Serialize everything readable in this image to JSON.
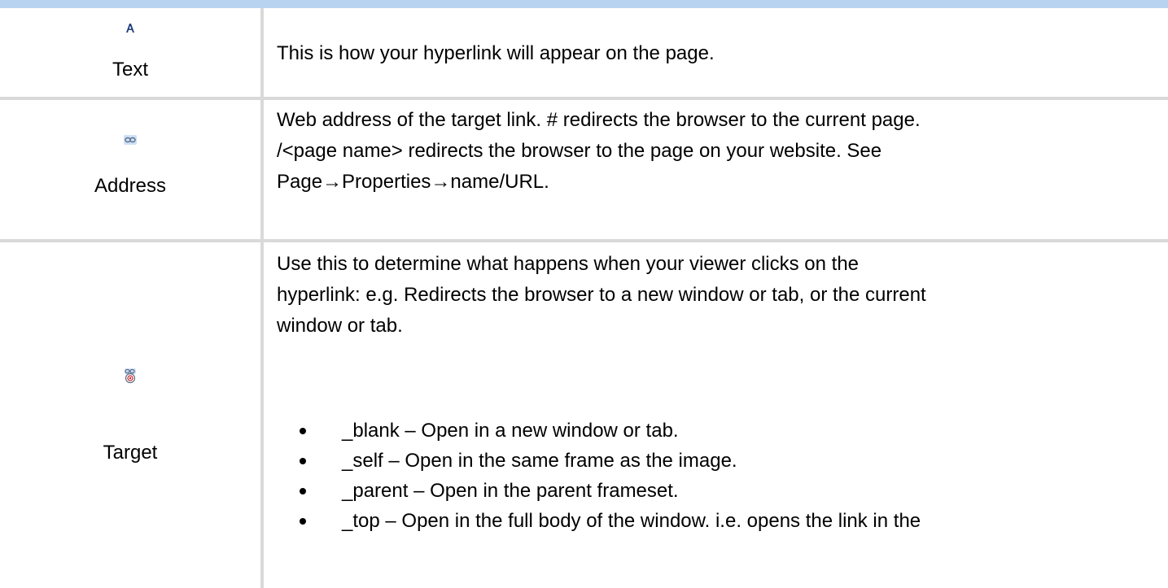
{
  "rows": [
    {
      "label": "Text",
      "icon": "text-color-icon",
      "description": "This is how your hyperlink will appear on the page."
    },
    {
      "label": "Address",
      "icon": "link-icon",
      "description_lines": [
        "Web address of the target link.  # redirects the browser to the current page.",
        "/<page name> redirects the browser to the page on your website.  See",
        "Page→Properties→name/URL."
      ]
    },
    {
      "label": "Target",
      "icon": "link-target-icon",
      "description_lines": [
        "Use this to determine what happens when your viewer clicks on the",
        "hyperlink: e.g. Redirects the browser to a new window or tab, or the current",
        "window or tab."
      ],
      "bullets": [
        "_blank – Open in a new window or tab.",
        "_self – Open in the same frame as the image.",
        "_parent – Open in the parent frameset.",
        "_top – Open in the full body of the window.  i.e. opens the link in the"
      ]
    }
  ],
  "colors": {
    "top_bar": "#b8d3f0",
    "grid": "#d9d9d9"
  }
}
